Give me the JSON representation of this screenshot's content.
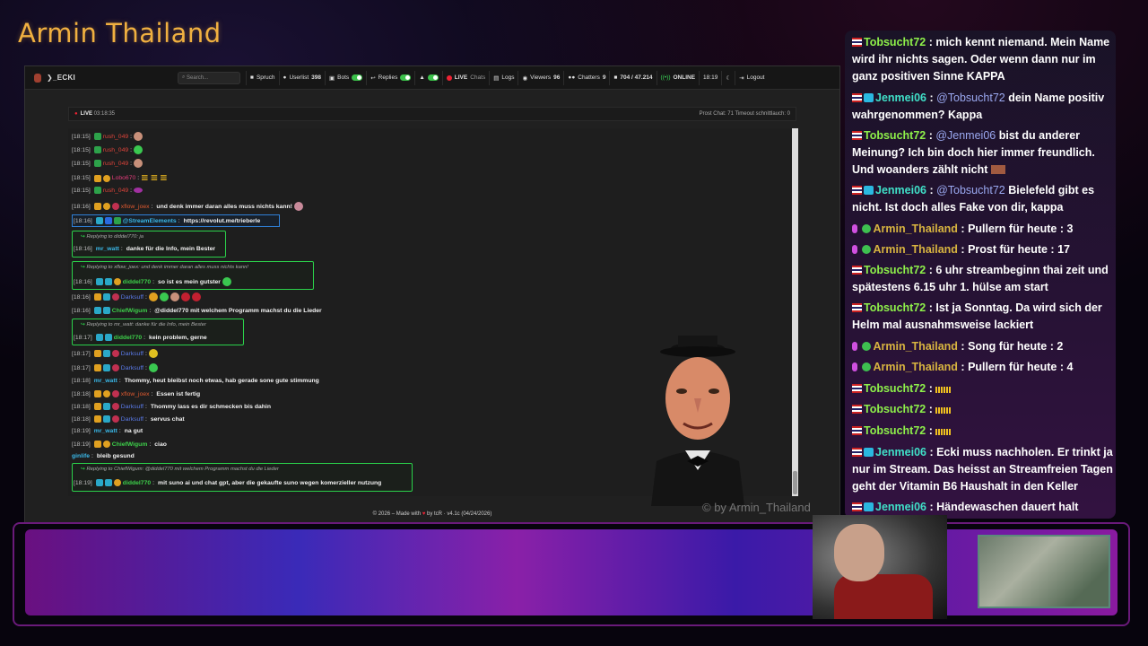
{
  "brand_title": "Armin Thailand",
  "app": {
    "brand": "ECKI",
    "search_placeholder": "Search...",
    "nav": {
      "spruch": "Spruch",
      "userlist": "Userlist",
      "userlist_count": "398",
      "bots": "Bots",
      "replies": "Replies",
      "live": "LIVE",
      "chats": "Chats",
      "logs": "Logs",
      "viewers": "Viewers",
      "viewers_count": "96",
      "chatters": "Chatters",
      "chatters_count": "9",
      "messages": "704 / 47.214",
      "online": "ONLINE",
      "time": "18:19",
      "logout": "Logout"
    },
    "status": {
      "live_label": "LIVE",
      "uptime": "03:18:35",
      "right": "Prost Chat: 71 Timeout schnittlauch: 0"
    },
    "chat": [
      {
        "ts": "[18:15]",
        "user": "rush_049",
        "text": ":"
      },
      {
        "ts": "[18:15]",
        "user": "rush_049",
        "text": ":"
      },
      {
        "ts": "[18:15]",
        "user": "rush_049",
        "text": ":"
      },
      {
        "ts": "[18:15]",
        "user": "Lobo670",
        "text": ":"
      },
      {
        "ts": "[18:15]",
        "user": "rush_049",
        "text": ":"
      },
      {
        "ts": "[18:16]",
        "user": "xflow_joex",
        "text": "und denk immer daran alles muss nichts kann!"
      },
      {
        "ts": "[18:16]",
        "user": "@StreamElements",
        "text": "https://revolut.me/trieberle"
      },
      {
        "reply": "Replying to diddel770: ja",
        "ts": "[18:16]",
        "user": "mr_watt",
        "text": "danke für die Info, mein Bester"
      },
      {
        "reply": "Replying to xflow_joex: und denk immer daran alles muss nichts kann!",
        "ts": "[18:16]",
        "user": "diddel770",
        "text": "so ist es mein gutster"
      },
      {
        "ts": "[18:16]",
        "user": "Darksuff",
        "text": ":"
      },
      {
        "ts": "[18:16]",
        "user": "ChiefWigum",
        "text": "@diddel770 mit welchem Programm machst du die Lieder"
      },
      {
        "reply": "Replying to mr_watt: danke für die Info, mein Bester",
        "ts": "[18:17]",
        "user": "diddel770",
        "text": "kein problem, gerne"
      },
      {
        "ts": "[18:17]",
        "user": "Darksuff",
        "text": ":"
      },
      {
        "ts": "[18:17]",
        "user": "Darksuff",
        "text": ":"
      },
      {
        "ts": "[18:18]",
        "user": "mr_watt",
        "text": "Thommy, heut bleibst noch etwas, hab gerade sone gute stimmung"
      },
      {
        "ts": "[18:18]",
        "user": "xflow_joex",
        "text": "Essen ist fertig"
      },
      {
        "ts": "[18:18]",
        "user": "Darksuff",
        "text": "Thommy lass es dir schmecken bis dahin"
      },
      {
        "ts": "[18:18]",
        "user": "Darksuff",
        "text": "servus chat"
      },
      {
        "ts": "[18:19]",
        "user": "mr_watt",
        "text": "na gut"
      },
      {
        "ts": "[18:19]",
        "user": "ChiefWigum",
        "text": "ciao"
      },
      {
        "ts": "[18:19]",
        "user": "ginlife",
        "text": "bleib gesund"
      },
      {
        "reply": "Replying to ChiefWigum: @diddel770 mit welchem Programm machst du die Lieder",
        "ts": "[18:19]",
        "user": "diddel770",
        "text": "mit suno ai und chat gpt, aber die gekaufte suno wegen komerzieller nutzung"
      }
    ],
    "watermark": "© by Armin_Thailand",
    "footer": {
      "pre": "© 2026 – Made with",
      "post": "by tcR · v4.1c (04/24/2026)"
    }
  },
  "overlay_chat": [
    {
      "user": "Tobsucht72",
      "text": "mich kennt niemand. Mein Name wird ihr nichts sagen. Oder wenn dann nur im ganz positiven Sinne KAPPA"
    },
    {
      "user": "Jenmei06",
      "mention": "@Tobsucht72",
      "text": "dein Name positiv wahrgenommen? Kappa"
    },
    {
      "user": "Tobsucht72",
      "mention": "@Jenmei06",
      "text": "bist du anderer Meinung? Ich bin doch hier immer freundlich. Und woanders zählt nicht"
    },
    {
      "user": "Jenmei06",
      "mention": "@Tobsucht72",
      "text": "Bielefeld gibt es nicht. Ist doch alles Fake von dir, kappa"
    },
    {
      "user": "Armin_Thailand",
      "text": "Pullern für heute : 3"
    },
    {
      "user": "Armin_Thailand",
      "text": "Prost für heute : 17"
    },
    {
      "user": "Tobsucht72",
      "text": "6 uhr streambeginn thai zeit und spätestens 6.15 uhr 1. hülse am start"
    },
    {
      "user": "Tobsucht72",
      "text": "Ist ja Sonntag. Da wird sich der Helm mal ausnahmsweise lackiert"
    },
    {
      "user": "Armin_Thailand",
      "text": "Song für heute : 2"
    },
    {
      "user": "Armin_Thailand",
      "text": "Pullern für heute : 4"
    },
    {
      "user": "Tobsucht72",
      "text": ""
    },
    {
      "user": "Tobsucht72",
      "text": ""
    },
    {
      "user": "Tobsucht72",
      "text": ""
    },
    {
      "user": "Jenmei06",
      "text": "Ecki muss nachholen. Er trinkt ja nur im Stream. Das heisst an Streamfreien Tagen geht der Vitamin B6 Haushalt in den Keller"
    },
    {
      "user": "Jenmei06",
      "text": "Händewaschen dauert halt"
    }
  ]
}
